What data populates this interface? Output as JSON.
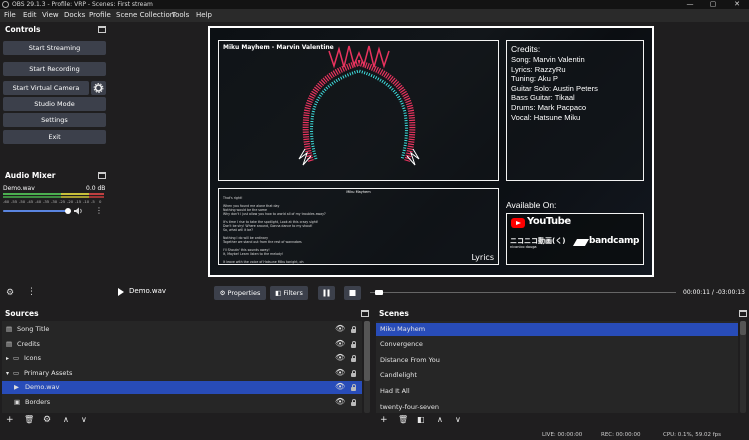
{
  "window": {
    "title": "OBS 29.1.3 - Profile: VRP - Scenes: First stream",
    "minimize": "—",
    "maximize": "▢",
    "close": "✕"
  },
  "menu": [
    "File",
    "Edit",
    "View",
    "Docks",
    "Profile",
    "Scene Collection",
    "Tools",
    "Help"
  ],
  "controls": {
    "title": "Controls",
    "start_streaming": "Start Streaming",
    "start_recording": "Start Recording",
    "start_virtual_camera": "Start Virtual Camera",
    "studio_mode": "Studio Mode",
    "settings": "Settings",
    "exit": "Exit"
  },
  "audio_mixer": {
    "title": "Audio Mixer",
    "track_name": "Demo.wav",
    "level": "0.0 dB",
    "scale": [
      "-60",
      "-55",
      "-50",
      "-45",
      "-40",
      "-35",
      "-30",
      "-25",
      "-20",
      "-15",
      "-10",
      "-5",
      "0"
    ],
    "volume_fraction": 0.95
  },
  "preview": {
    "song_title": "Miku Mayhem - Marvin Valentine",
    "credits_heading": "Credits:",
    "credits": [
      "Song: Marvin Valentin",
      "Lyrics: RazzyRu",
      "Tuning: Aku P",
      "Guitar Solo: Austin Peters",
      "Bass Guitar: Tikaal",
      "Drums: Mark Pacpaco",
      "Vocal: Hatsune Miku"
    ],
    "lyrics_heading": "Miku Mayhem",
    "lyrics_lines": [
      "That's right!",
      "",
      "When you found me alone that day",
      "Nothing would be the same",
      "Why don't I just allow you how to world all of my troubles away?",
      "",
      "It's time I rise to take the spotlight, Look at this crazy sight!",
      "Don't be shy! Where around, Gonna dance to my shout!",
      "So, what will it be?",
      "",
      "Nothing I do will be ordinary",
      "Together we stand out from the rest of wannabes",
      "",
      "I'll Shoutn' this sounds away!",
      "It, Maybe! Learn listen to the melody!",
      "",
      "It leave with the voice of Hatsune Miku tonight, oh"
    ],
    "lyrics_label": "Lyrics",
    "available_on": "Available On:",
    "youtube_label": "YouTube",
    "niconico_label": "ニコニコ動画(く)",
    "niconico_sub": "niconico douga",
    "bandcamp_label": "bandcamp"
  },
  "transport": {
    "media_name": "Demo.wav",
    "properties": "Properties",
    "filters": "Filters",
    "time_current": "00:00:11",
    "time_separator": "/",
    "time_remaining": "-03:00:13",
    "progress_fraction": 0.015
  },
  "sources": {
    "title": "Sources",
    "items": [
      {
        "label": "Song Title",
        "icon": "text-icon",
        "group": false,
        "selected": false
      },
      {
        "label": "Credits",
        "icon": "text-icon",
        "group": false,
        "selected": false
      },
      {
        "label": "Icons",
        "icon": "folder-icon",
        "group": true,
        "selected": false
      },
      {
        "label": "Primary Assets",
        "icon": "folder-icon",
        "group": true,
        "selected": false
      },
      {
        "label": "Demo.wav",
        "icon": "play-icon",
        "group": false,
        "selected": true
      },
      {
        "label": "Borders",
        "icon": "image-icon",
        "group": false,
        "selected": false
      }
    ]
  },
  "scenes": {
    "title": "Scenes",
    "items": [
      {
        "label": "Miku Mayhem",
        "selected": true
      },
      {
        "label": "Convergence",
        "selected": false
      },
      {
        "label": "Distance From You",
        "selected": false
      },
      {
        "label": "Candlelight",
        "selected": false
      },
      {
        "label": "Had It All",
        "selected": false
      },
      {
        "label": "twenty-four-seven",
        "selected": false
      }
    ]
  },
  "status": {
    "live": "LIVE: 00:00:00",
    "rec": "REC: 00:00:00",
    "cpu": "CPU: 0.1%, 59.02 fps"
  },
  "colors": {
    "accent": "#284cb8",
    "button": "#3c404b",
    "background": "#1f1e1f",
    "youtube_red": "#ff0000",
    "wave_pink": "#e8335e",
    "wave_cyan": "#3fe0e0"
  }
}
